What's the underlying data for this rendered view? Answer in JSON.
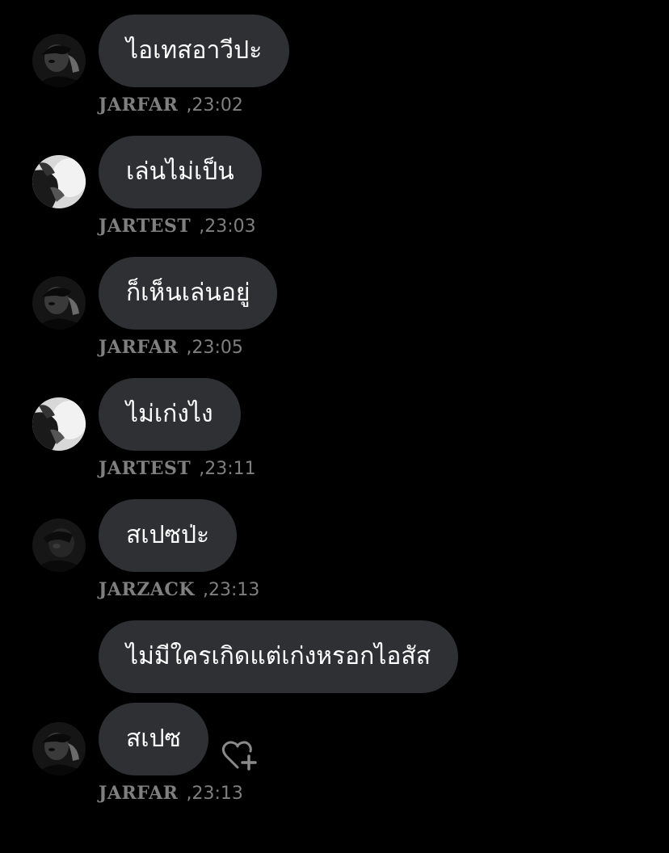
{
  "messages": [
    {
      "avatar": "avatar-jarfar",
      "text": "ไอเทสอาวีปะ",
      "sender": "JARFAR",
      "time": ",23:02"
    },
    {
      "avatar": "avatar-jartest",
      "text": "เล่นไม่เป็น",
      "sender": "JARTEST",
      "time": ",23:03"
    },
    {
      "avatar": "avatar-jarfar",
      "text": "ก็เห็นเล่นอยู่",
      "sender": "JARFAR",
      "time": ",23:05"
    },
    {
      "avatar": "avatar-jartest",
      "text": "ไม่เก่งไง",
      "sender": "JARTEST",
      "time": ",23:11"
    },
    {
      "avatar": "avatar-jarzack",
      "text": "สเปซป่ะ",
      "sender": "JARZACK",
      "time": ",23:13"
    },
    {
      "text": "ไม่มีใครเกิดแต่เก่งหรอกไอสัส"
    },
    {
      "avatar": "avatar-jarfar",
      "text": "สเปซ",
      "sender": "JARFAR",
      "time": ",23:13"
    }
  ],
  "react_icon": "heart-plus-icon",
  "colors": {
    "background": "#000000",
    "bubble": "#2e3033",
    "message_text": "#ffffff",
    "meta_text": "#7f7f7f"
  }
}
